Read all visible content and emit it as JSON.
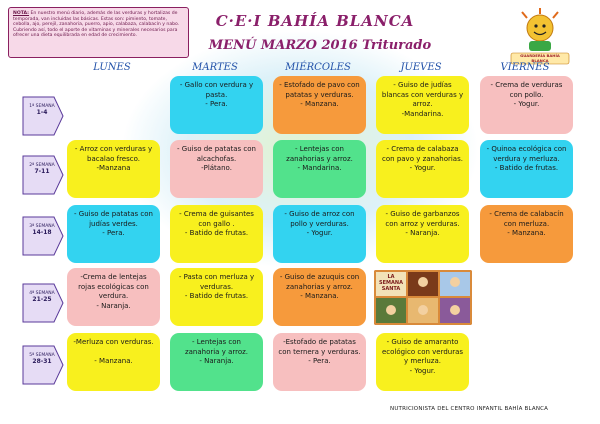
{
  "note": {
    "label": "NOTA:",
    "text": "En nuestro menú diario, además de las verduras y hortalizas de temporada, van incluidas las básicas. Estas son: pimiento, tomate, cebolla, ajo, perejil, zanahoria, puerro, apio, calabaza, calabacín y nabo. Cubriendo así, todo el aporte de vitaminas y minerales necesarios para ofrecer una dieta equilibrada en edad de crecimiento."
  },
  "header": {
    "title": "C·E·I BAHÍA BLANCA",
    "subtitle": "MENÚ MARZO 2016  Triturado",
    "logo_text": "GUARDERÍA BAHÍA BLANCA"
  },
  "days": [
    "LUNES",
    "MARTES",
    "MIÉRCOLES",
    "JUEVES",
    "VIERNES"
  ],
  "weeks": [
    {
      "label": "1ª SEMANA",
      "range": "1-4"
    },
    {
      "label": "2ª SEMANA",
      "range": "7-11"
    },
    {
      "label": "3ª SEMANA",
      "range": "14-18"
    },
    {
      "label": "4ª SEMANA",
      "range": "21-25"
    },
    {
      "label": "5ª SEMANA",
      "range": "28-31"
    }
  ],
  "menu": {
    "w1": {
      "martes": "- Gallo con verdura y pasta.\n- Pera.",
      "miercoles": "- Estofado de pavo con patatas y verduras.\n- Manzana.",
      "jueves": "- Guiso de judías blancas con verduras y arroz.\n-Mandarina.",
      "viernes": "- Crema de verduras con pollo.\n- Yogur."
    },
    "w2": {
      "lunes": "- Arroz con verduras y bacalao fresco.\n-Manzana",
      "martes": "- Guiso de patatas con alcachofas.\n-Plátano.",
      "miercoles": "- Lentejas con zanahorias y arroz.\n- Mandarina.",
      "jueves": "- Crema de calabaza con pavo y zanahorias.\n- Yogur.",
      "viernes": "- Quinoa ecológica con verdura y merluza.\n- Batido de frutas."
    },
    "w3": {
      "lunes": "- Guiso de patatas con judías verdes.\n- Pera.",
      "martes": "- Crema de guisantes con gallo .\n- Batido de frutas.",
      "miercoles": "- Guiso de arroz con pollo y verduras.\n- Yogur.",
      "jueves": "- Guiso de garbanzos con arroz y verduras.\n- Naranja.",
      "viernes": "- Crema de calabacín con merluza.\n- Manzana."
    },
    "w4": {
      "lunes": "-Crema de lentejas rojas ecológicas con verdura.\n- Naranja.",
      "martes": "- Pasta con merluza y verduras.\n- Batido de frutas.",
      "miercoles": "- Guiso de azuquis con zanahorias y arroz.\n- Manzana.",
      "holiday_label": "LA SEMANA SANTA"
    },
    "w5": {
      "lunes": "-Merluza con verduras.\n\n- Manzana.",
      "martes": "- Lentejas con zanahoria y arroz.\n- Naranja.",
      "miercoles": "-Estofado de patatas con ternera y verduras.\n- Pera.",
      "jueves": "- Guiso de amaranto ecológico con verduras y merluza.\n- Yogur."
    }
  },
  "footer": "NUTRICIONISTA DEL CENTRO INFANTIL BAHÍA BLANCA",
  "colors": {
    "title": "#8a1f6a",
    "days": "#2050a8",
    "cyan": "#33d3f0",
    "orange": "#f69a3c",
    "yellow": "#f8f01e",
    "pink": "#f7bfbf",
    "green": "#52e28c"
  }
}
